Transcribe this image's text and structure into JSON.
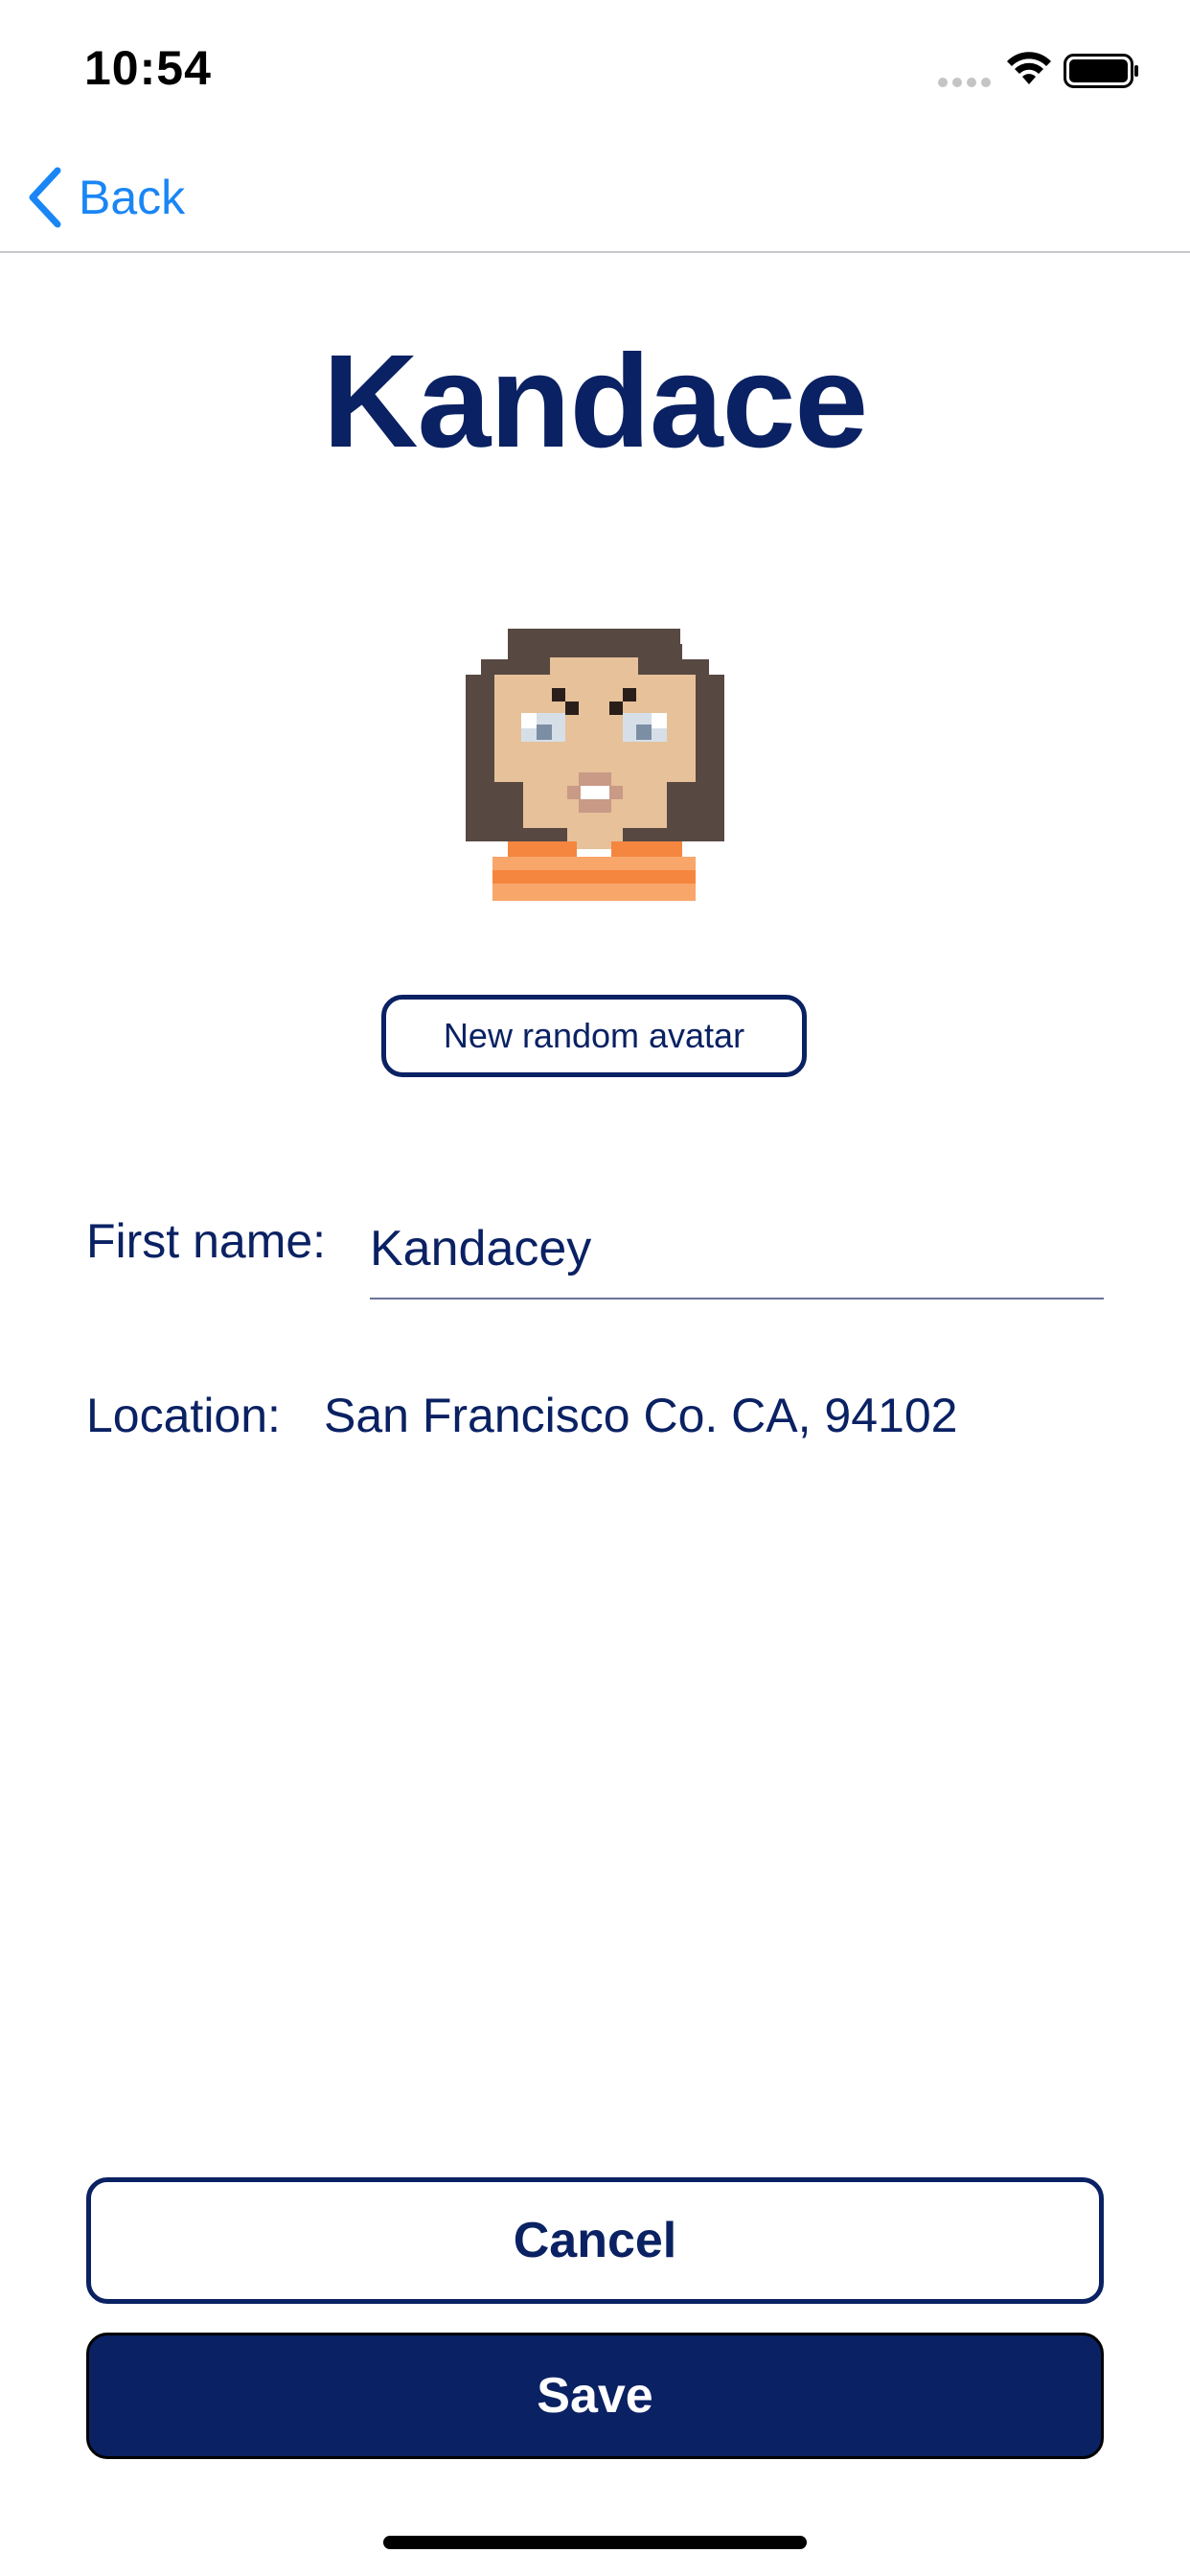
{
  "status_bar": {
    "time": "10:54"
  },
  "nav": {
    "back_label": "Back"
  },
  "profile": {
    "title": "Kandace",
    "random_avatar_label": "New random avatar"
  },
  "form": {
    "first_name_label": "First name:",
    "first_name_value": "Kandacey",
    "location_label": "Location:",
    "location_value": "San Francisco Co. CA, 94102"
  },
  "actions": {
    "cancel_label": "Cancel",
    "save_label": "Save"
  },
  "colors": {
    "primary": "#0a2163",
    "ios_blue": "#1a86f5",
    "hair": "#574842",
    "skin": "#e6c199",
    "shirt": "#f5863f",
    "shirt_stripe": "#f9a66b"
  }
}
